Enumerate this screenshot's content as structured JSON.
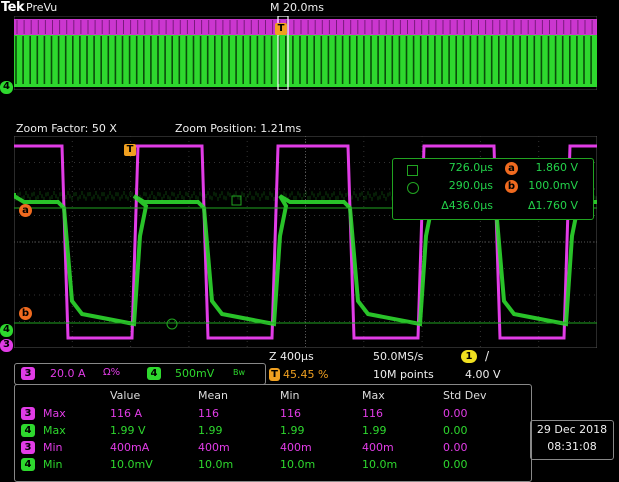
{
  "header": {
    "logo": "Tek",
    "mode": "PreVu",
    "horizontal": "M 20.0ms",
    "trigger_marker": "T"
  },
  "zoom_info": {
    "factor": "Zoom Factor: 50 X",
    "position": "Zoom Position: 1.21ms"
  },
  "markers": {
    "ch4_overview": "4",
    "ch4": "4",
    "ch3": "3",
    "cursor_a": "a",
    "cursor_b": "b"
  },
  "cursors": {
    "t1": "726.0µs",
    "t2": "290.0µs",
    "dt": "Δ436.0µs",
    "v1": "1.860 V",
    "v2": "100.0mV",
    "dv": "Δ1.760 V"
  },
  "channels": {
    "ch3_num": "3",
    "ch3_scale": "20.0 A",
    "ch3_coupling": "Ω%",
    "ch4_num": "4",
    "ch4_scale": "500mV",
    "ch4_bw": "Bw"
  },
  "timebase": {
    "zoom_scale": "Z 400µs",
    "sample_rate": "50.0MS/s",
    "trigger_pos": "45.45 %",
    "record_length": "10M points",
    "trigger_source": "1",
    "trigger_slope": "/",
    "trigger_level": "4.00 V"
  },
  "measurements": {
    "headers": [
      "Value",
      "Mean",
      "Min",
      "Max",
      "Std Dev"
    ],
    "rows": [
      {
        "ch": "3",
        "name": "Max",
        "value": "116 A",
        "mean": "116",
        "min": "116",
        "max": "116",
        "std": "0.00"
      },
      {
        "ch": "4",
        "name": "Max",
        "value": "1.99 V",
        "mean": "1.99",
        "min": "1.99",
        "max": "1.99",
        "std": "0.00"
      },
      {
        "ch": "3",
        "name": "Min",
        "value": "400mA",
        "mean": "400m",
        "min": "400m",
        "max": "400m",
        "std": "0.00"
      },
      {
        "ch": "4",
        "name": "Min",
        "value": "10.0mV",
        "mean": "10.0m",
        "min": "10.0m",
        "max": "10.0m",
        "std": "0.00"
      }
    ]
  },
  "datetime": {
    "date": "29 Dec  2018",
    "time": "08:31:08"
  },
  "colors": {
    "ch3": "#e13ce6",
    "ch4": "#2ed82e",
    "cursor": "#f06a1f",
    "trigger": "#f0a020",
    "ch1": "#f0e020"
  }
}
